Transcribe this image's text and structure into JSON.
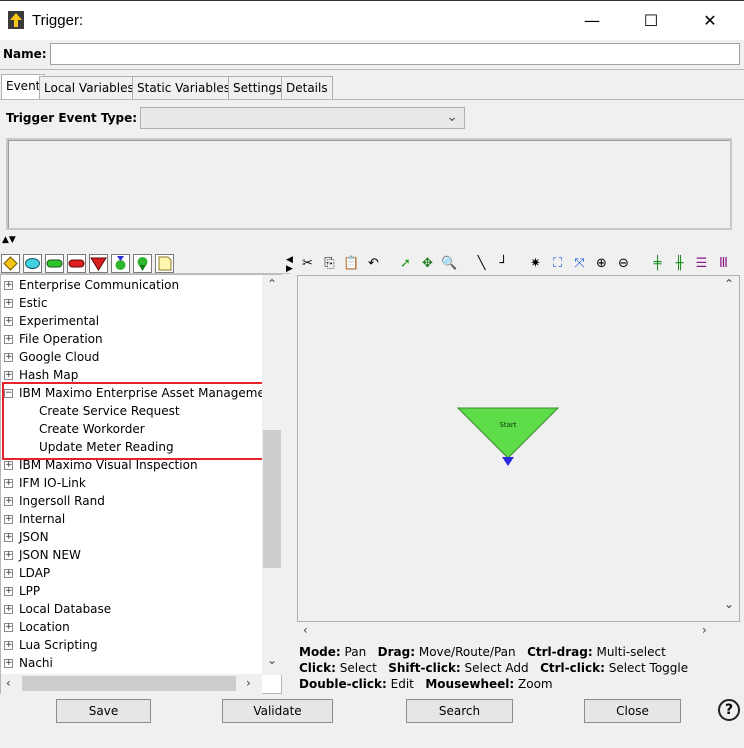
{
  "window": {
    "title": "Trigger:",
    "minimize": "—",
    "maximize": "☐",
    "close": "✕"
  },
  "name_field": {
    "label": "Name:",
    "value": ""
  },
  "tabs": [
    {
      "label": "Event",
      "active": true
    },
    {
      "label": "Local Variables",
      "active": false
    },
    {
      "label": "Static Variables",
      "active": false
    },
    {
      "label": "Settings",
      "active": false
    },
    {
      "label": "Details",
      "active": false
    }
  ],
  "event": {
    "trigger_event_type_label": "Trigger Event Type:",
    "trigger_event_type_value": ""
  },
  "left_toolbar_icons": [
    "diamond-icon",
    "oval-icon",
    "green-pill-icon",
    "red-pill-icon",
    "red-triangle-icon",
    "hourglass-icon",
    "pin-icon",
    "note-icon"
  ],
  "tree": {
    "items": [
      {
        "label": "Enterprise Communication",
        "expanded": false
      },
      {
        "label": "Estic",
        "expanded": false
      },
      {
        "label": "Experimental",
        "expanded": false
      },
      {
        "label": "File Operation",
        "expanded": false
      },
      {
        "label": "Google Cloud",
        "expanded": false
      },
      {
        "label": "Hash Map",
        "expanded": false
      },
      {
        "label": "IBM Maximo Enterprise Asset Management",
        "expanded": true,
        "children": [
          "Create Service Request",
          "Create Workorder",
          "Update Meter Reading"
        ]
      },
      {
        "label": "IBM Maximo Visual Inspection",
        "expanded": false
      },
      {
        "label": "IFM IO-Link",
        "expanded": false
      },
      {
        "label": "Ingersoll Rand",
        "expanded": false
      },
      {
        "label": "Internal",
        "expanded": false
      },
      {
        "label": "JSON",
        "expanded": false
      },
      {
        "label": "JSON NEW",
        "expanded": false
      },
      {
        "label": "LDAP",
        "expanded": false
      },
      {
        "label": "LPP",
        "expanded": false
      },
      {
        "label": "Local Database",
        "expanded": false
      },
      {
        "label": "Location",
        "expanded": false
      },
      {
        "label": "Lua Scripting",
        "expanded": false
      },
      {
        "label": "Nachi",
        "expanded": false
      }
    ]
  },
  "canvas": {
    "start_node_label": "Start",
    "start_node_color": "#5fdc4a"
  },
  "status": {
    "line1": [
      {
        "k": "Mode:",
        "v": "Pan"
      },
      {
        "k": "Drag:",
        "v": "Move/Route/Pan"
      },
      {
        "k": "Ctrl-drag:",
        "v": "Multi-select"
      }
    ],
    "line2": [
      {
        "k": "Click:",
        "v": "Select"
      },
      {
        "k": "Shift-click:",
        "v": "Select Add"
      },
      {
        "k": "Ctrl-click:",
        "v": "Select Toggle"
      }
    ],
    "line3": [
      {
        "k": "Double-click:",
        "v": "Edit"
      },
      {
        "k": "Mousewheel:",
        "v": "Zoom"
      }
    ]
  },
  "buttons": {
    "save": "Save",
    "validate": "Validate",
    "search": "Search",
    "close": "Close",
    "help": "?"
  },
  "colors": {
    "highlight": "#e3242b",
    "start_node": "#5fdc4a",
    "start_port": "#2a2adc"
  }
}
